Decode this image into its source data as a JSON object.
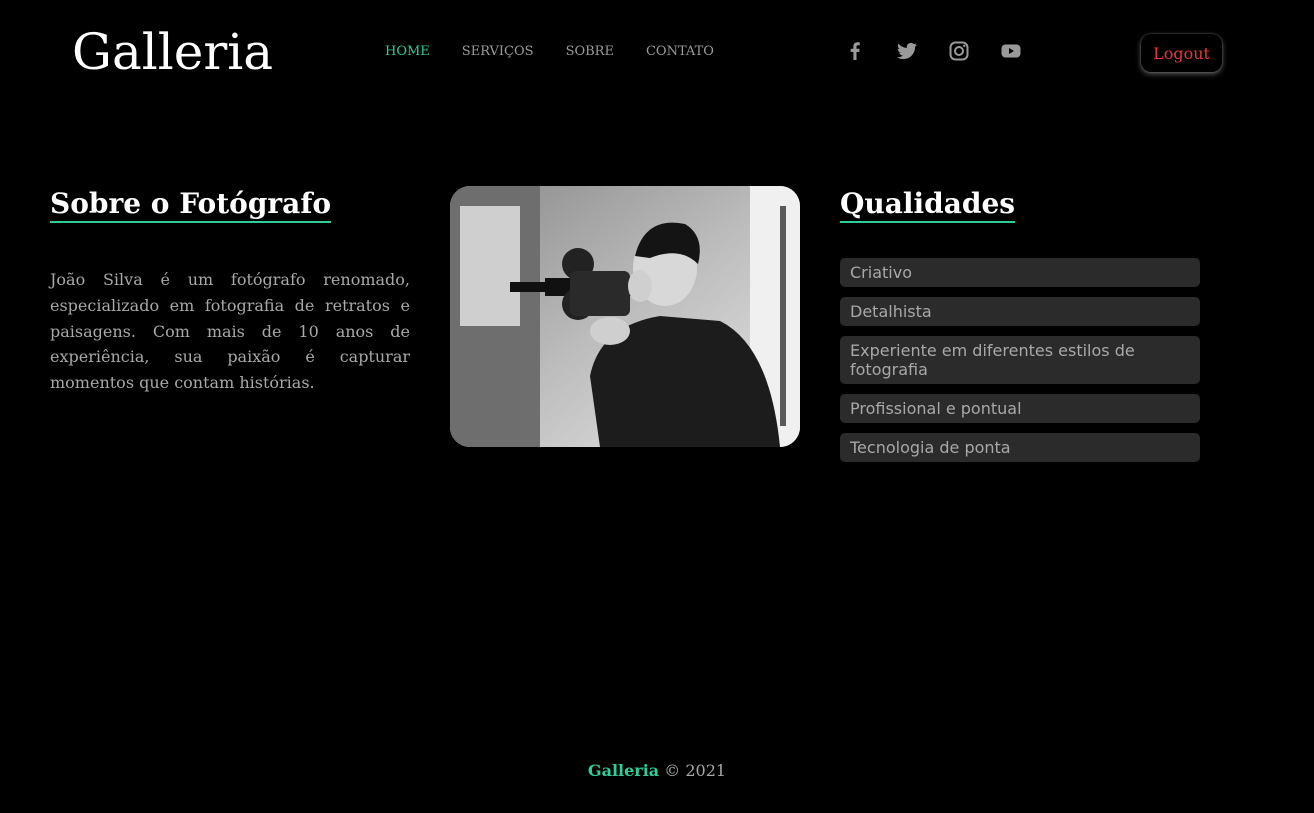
{
  "header": {
    "logo": "Galleria",
    "nav": [
      {
        "label": "HOME",
        "active": true
      },
      {
        "label": "SERVIÇOS",
        "active": false
      },
      {
        "label": "SOBRE",
        "active": false
      },
      {
        "label": "CONTATO",
        "active": false
      }
    ],
    "social": [
      "facebook-icon",
      "twitter-icon",
      "instagram-icon",
      "youtube-icon"
    ],
    "logout_label": "Logout"
  },
  "about": {
    "title": "Sobre o Fotógrafo",
    "text": "João Silva é um fotógrafo renomado, especializado em fotografia de retratos e paisagens. Com mais de 10 anos de experiência, sua paixão é capturar momentos que contam histórias."
  },
  "qualities": {
    "title": "Qualidades",
    "items": [
      "Criativo",
      "Detalhista",
      "Experiente em diferentes estilos de fotografia",
      "Profissional e pontual",
      "Tecnologia de ponta"
    ]
  },
  "footer": {
    "brand": "Galleria",
    "copyright": "© 2021"
  },
  "colors": {
    "accent": "#2ecc9a",
    "logout": "#e53935",
    "background": "#000000",
    "muted_text": "#a8a8a8",
    "list_bg": "#2b2b2b"
  }
}
